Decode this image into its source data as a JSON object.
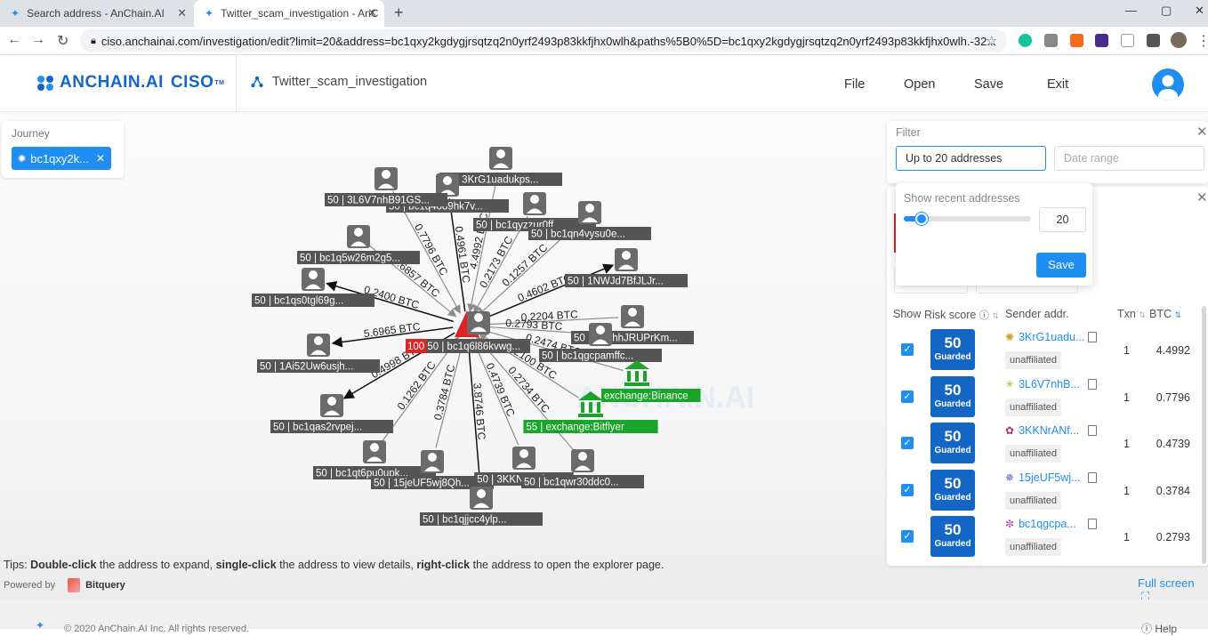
{
  "browser": {
    "tabs": [
      {
        "title": "Search address - AnChain.AI"
      },
      {
        "title": "Twitter_scam_investigation - AnC"
      }
    ],
    "url": "ciso.anchainai.com/investigation/edit?limit=20&address=bc1qxy2kgdygjrsqtzq2n0yrf2493p83kkfjhx0wlh&paths%5B0%5D=bc1qxy2kgdygjrsqtzq2n0yrf2493p83kkfjhx0wlh.-32..."
  },
  "header": {
    "logo_text": "ANCHAIN.AI",
    "logo_product": "CISO",
    "logo_tm": "TM",
    "investigation_title": "Twitter_scam_investigation",
    "menu": [
      "File",
      "Open",
      "Save",
      "Exit"
    ]
  },
  "journey": {
    "label": "Journey",
    "chip": "bc1qxy2k..."
  },
  "filter": {
    "title": "Filter",
    "limit_value": "Up to 20 addresses",
    "date_placeholder": "Date range"
  },
  "recent_popup": {
    "label": "Show recent addresses",
    "value": "20",
    "save": "Save",
    "slider_fraction": 0.14
  },
  "table": {
    "headers": {
      "show": "Show",
      "risk": "Risk score",
      "sender": "Sender addr.",
      "txn": "Txn",
      "btc": "BTC"
    },
    "rows": [
      {
        "score": "50",
        "badge": "Guarded",
        "addr": "3KrG1uadu...",
        "tag": "unaffiliated",
        "txn": "1",
        "btc": "4.4992"
      },
      {
        "score": "50",
        "badge": "Guarded",
        "addr": "3L6V7nhB...",
        "tag": "unaffiliated",
        "txn": "1",
        "btc": "0.7796"
      },
      {
        "score": "50",
        "badge": "Guarded",
        "addr": "3KKNrANf...",
        "tag": "unaffiliated",
        "txn": "1",
        "btc": "0.4739"
      },
      {
        "score": "50",
        "badge": "Guarded",
        "addr": "15jeUF5wj...",
        "tag": "unaffiliated",
        "txn": "1",
        "btc": "0.3784"
      },
      {
        "score": "50",
        "badge": "Guarded",
        "addr": "bc1qgcpa...",
        "tag": "unaffiliated",
        "txn": "1",
        "btc": "0.2793"
      }
    ]
  },
  "graph": {
    "center_label": "100 50 | bc1q6l86kvwg...",
    "nodes": [
      {
        "label": "50 | 3KrG1uadukps...",
        "edge": "4.4992 BTC",
        "kind": "person",
        "dir": "in"
      },
      {
        "label": "50 | bc1q4089hk7v...",
        "edge": "0.4961 BTC",
        "kind": "person",
        "dir": "out"
      },
      {
        "label": "50 | 3L6V7nhB91GS...",
        "edge": "0.7796 BTC",
        "kind": "person",
        "dir": "in"
      },
      {
        "label": "50 | bc1qyzzur0ff...",
        "edge": "0.2173 BTC",
        "kind": "person",
        "dir": "in"
      },
      {
        "label": "50 | bc1qn4vysu0e...",
        "edge": "0.1257 BTC",
        "kind": "person",
        "dir": "in"
      },
      {
        "label": "50 | bc1q5w26m2g5...",
        "edge": "0.6857 BTC",
        "kind": "person",
        "dir": "in"
      },
      {
        "label": "50 | 1NWJd7BfJLJr...",
        "edge": "0.4602 BTC",
        "kind": "person",
        "dir": "out"
      },
      {
        "label": "50 | bc1qs0tgl69g...",
        "edge": "0.2400 BTC",
        "kind": "person",
        "dir": "out"
      },
      {
        "label": "50 | 3GyhhJRUPrKm...",
        "edge": "0.2204 BTC",
        "kind": "person",
        "dir": "in"
      },
      {
        "label": "50 | bc1qgcpamffc...",
        "edge": "0.2793 BTC",
        "kind": "person",
        "dir": "in"
      },
      {
        "label": "50 | 1Ai52Uw6usjh...",
        "edge": "5.6965 BTC",
        "kind": "person",
        "dir": "out"
      },
      {
        "label": "exchange:Binance",
        "edge": "0.2474 BTC",
        "kind": "exchange",
        "dir": "in"
      },
      {
        "label": "55 | exchange:Bitflyer",
        "edge": "0.2100 BTC",
        "kind": "exchange",
        "dir": "in"
      },
      {
        "label": "50 | bc1qas2rvpej...",
        "edge": "0.4998 BTC",
        "kind": "person",
        "dir": "out"
      },
      {
        "label": "50 | bc1qt6pu0upk...",
        "edge": "0.1262 BTC",
        "kind": "person",
        "dir": "in"
      },
      {
        "label": "50 | 15jeUF5wj8Qh...",
        "edge": "0.3784 BTC",
        "kind": "person",
        "dir": "in"
      },
      {
        "label": "50 | 3KKNrANf...",
        "edge": "0.4739 BTC",
        "kind": "person",
        "dir": "in"
      },
      {
        "label": "50 | bc1qwr30ddc0...",
        "edge": "0.2734 BTC",
        "kind": "person",
        "dir": "in"
      },
      {
        "label": "50 | bc1qjjcc4ylp...",
        "edge": "3.8746 BTC",
        "kind": "person",
        "dir": "out"
      }
    ]
  },
  "tips": {
    "prefix": "Tips: ",
    "b1": "Double-click",
    "t1": " the address to expand, ",
    "b2": "single-click",
    "t2": " the address to view details, ",
    "b3": "right-click",
    "t3": " the address to open the explorer page."
  },
  "powered": {
    "label": "Powered by",
    "brand": "Bitquery"
  },
  "fullscreen": "Full screen",
  "footer": {
    "copyright": "© 2020 AnChain.AI Inc. All rights reserved.",
    "help": "Help"
  }
}
